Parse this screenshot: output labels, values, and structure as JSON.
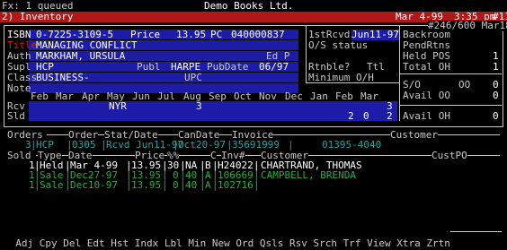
{
  "topbar": {
    "fx": "Fx: 1 queued",
    "store": "Demo Books Ltd."
  },
  "titlebar": {
    "screen": "2) Inventory",
    "date": "Mar 4-99",
    "time": "3:35 pm",
    "terminal": "#11"
  },
  "record": {
    "pos": "#246/600 Mar18-97"
  },
  "item": {
    "isbn_label": "ISBN",
    "isbn": "0-7225-3109-5",
    "price_label": "Price",
    "price": "13.95",
    "pc_label": "PC",
    "pc": "040000837",
    "title_label": "Title",
    "title": "MANAGING CONFLICT",
    "auth_label": "Auth",
    "auth": "MARKHAM, URSULA",
    "ed_label": "Ed P",
    "supl_label": "Supl",
    "supl": "HCP",
    "publ_label": "Publ",
    "publ": "HARPE",
    "pubdate_label": "PubDate",
    "pubdate": "06/97",
    "class_label": "Class",
    "class": "BUSINESS-",
    "upc_label": "UPC",
    "note_label": "Note"
  },
  "right_panel": {
    "first_rcvd_label": "1stRcvd",
    "first_rcvd": "Jun11-97",
    "os_status_label": "O/S status",
    "rtnble_label": "Rtnble?",
    "ttl_label": "Ttl",
    "min_oh_label": "Minimum O/H",
    "backroom_label": "Backroom",
    "pendrtns_label": "PendRtns",
    "held_pos_label": "Held POS",
    "held_pos": "1",
    "total_oh_label": "Total OH",
    "total_oh": "1",
    "so_label": "S/O",
    "so": "0",
    "oo_label": "OO",
    "oo": "0",
    "avail_label": "Avail OO",
    "avail": "0",
    "avail2_label": "Avail OH",
    "avail2": "0"
  },
  "months": {
    "header": [
      "Feb",
      "Mar",
      "Apr",
      "May",
      "Jun",
      "Jul",
      "Aug",
      "Sep",
      "Oct",
      "Nov",
      "Dec",
      "Jan",
      "Feb",
      "Mar"
    ],
    "rcv_label": "Rcv",
    "rcv_nyr": "NYR",
    "rcv_aug": "3",
    "rcv_total": "3",
    "sld_label": "Sld",
    "sld_feb": "2",
    "sld_mar": "0",
    "sld_total": "2"
  },
  "orders": {
    "headers": {
      "orders": "Orders",
      "order": "Order",
      "stat": "Stat/Date",
      "candate": "CanDate",
      "invoice": "Invoice",
      "customer": "Customer"
    },
    "row": {
      "qty": "3",
      "supl": "HCP",
      "order": "0305",
      "stat": "Rcvd Jun11-97",
      "candate": "Oct20-97",
      "invoice": "35691999",
      "customer": "01395-4040"
    }
  },
  "sold": {
    "headers": {
      "sold": "Sold",
      "type": "Type",
      "date": "Date",
      "price": "Price",
      "pct": "%%",
      "c": "C",
      "inv": "Inv#",
      "customer": "Customer",
      "custpo": "CustPO"
    },
    "rows": [
      {
        "qty": "1",
        "type": "Held",
        "date": "Mar 4-99",
        "price": "13.95",
        "pct": "30",
        "na": "NA",
        "c": "B",
        "inv": "H24022",
        "customer": "CHARTRAND, THOMAS"
      },
      {
        "qty": "1",
        "type": "Sale",
        "date": "Dec27-97",
        "price": "13.95",
        "pct": "0",
        "na": "40",
        "c": "A",
        "inv": "106669",
        "customer": "CAMPBELL, BRENDA"
      },
      {
        "qty": "1",
        "type": "Sale",
        "date": "Dec10-97",
        "price": "13.95",
        "pct": "0",
        "na": "40",
        "c": "A",
        "inv": "102716",
        "customer": ""
      }
    ]
  },
  "menu": [
    "Adj",
    "Cpy",
    "Del",
    "Edt",
    "Hst",
    "Indx",
    "Lbl",
    "Min",
    "New",
    "Ord",
    "Qsls",
    "Rsv",
    "Srch",
    "Trf",
    "View",
    "Xtra",
    "Zrtn"
  ]
}
